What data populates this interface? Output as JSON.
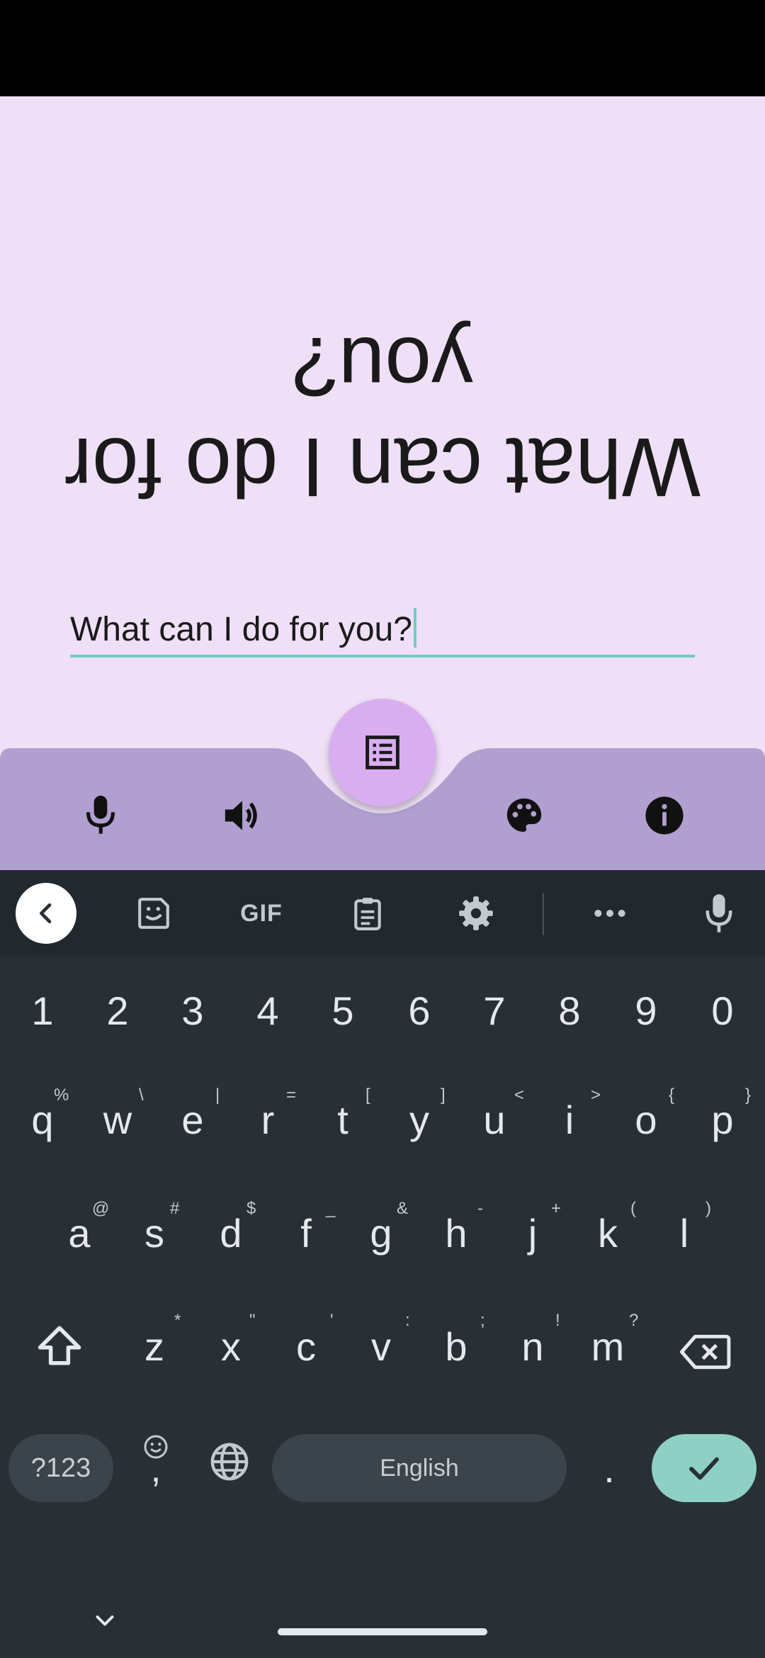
{
  "app": {
    "flipped_text": "What can I do for you?",
    "input_value": "What can I do for you?",
    "colors": {
      "background": "#efe0f7",
      "bottom_bar": "#b09fcf",
      "fab": "#d9aef0",
      "accent": "#6fcdc4"
    },
    "fab_icon": "list-icon",
    "bottom_bar_icons": [
      "microphone-icon",
      "speaker-icon",
      "palette-icon",
      "info-icon"
    ]
  },
  "keyboard": {
    "toolbar_icons": [
      "back-icon",
      "sticker-icon",
      "gif-icon",
      "clipboard-icon",
      "settings-icon",
      "more-icon",
      "microphone-icon"
    ],
    "gif_label": "GIF",
    "numbers": [
      "1",
      "2",
      "3",
      "4",
      "5",
      "6",
      "7",
      "8",
      "9",
      "0"
    ],
    "row_q": [
      "q",
      "w",
      "e",
      "r",
      "t",
      "y",
      "u",
      "i",
      "o",
      "p"
    ],
    "row_q_hints": [
      "%",
      "\\",
      "|",
      "=",
      "[",
      "]",
      "<",
      ">",
      "{",
      "}"
    ],
    "row_a": [
      "a",
      "s",
      "d",
      "f",
      "g",
      "h",
      "j",
      "k",
      "l"
    ],
    "row_a_hints": [
      "@",
      "#",
      "$",
      "_",
      "&",
      "-",
      "+",
      "(",
      ")"
    ],
    "row_z": [
      "z",
      "x",
      "c",
      "v",
      "b",
      "n",
      "m"
    ],
    "row_z_hints": [
      "*",
      "\"",
      "'",
      ":",
      ";",
      "!",
      "?"
    ],
    "symbols_label": "?123",
    "comma_label": ",",
    "space_label": "English",
    "period_label": ".",
    "colors": {
      "background": "#283036",
      "toolbar": "#21282e",
      "enter": "#8fd0c5"
    }
  }
}
